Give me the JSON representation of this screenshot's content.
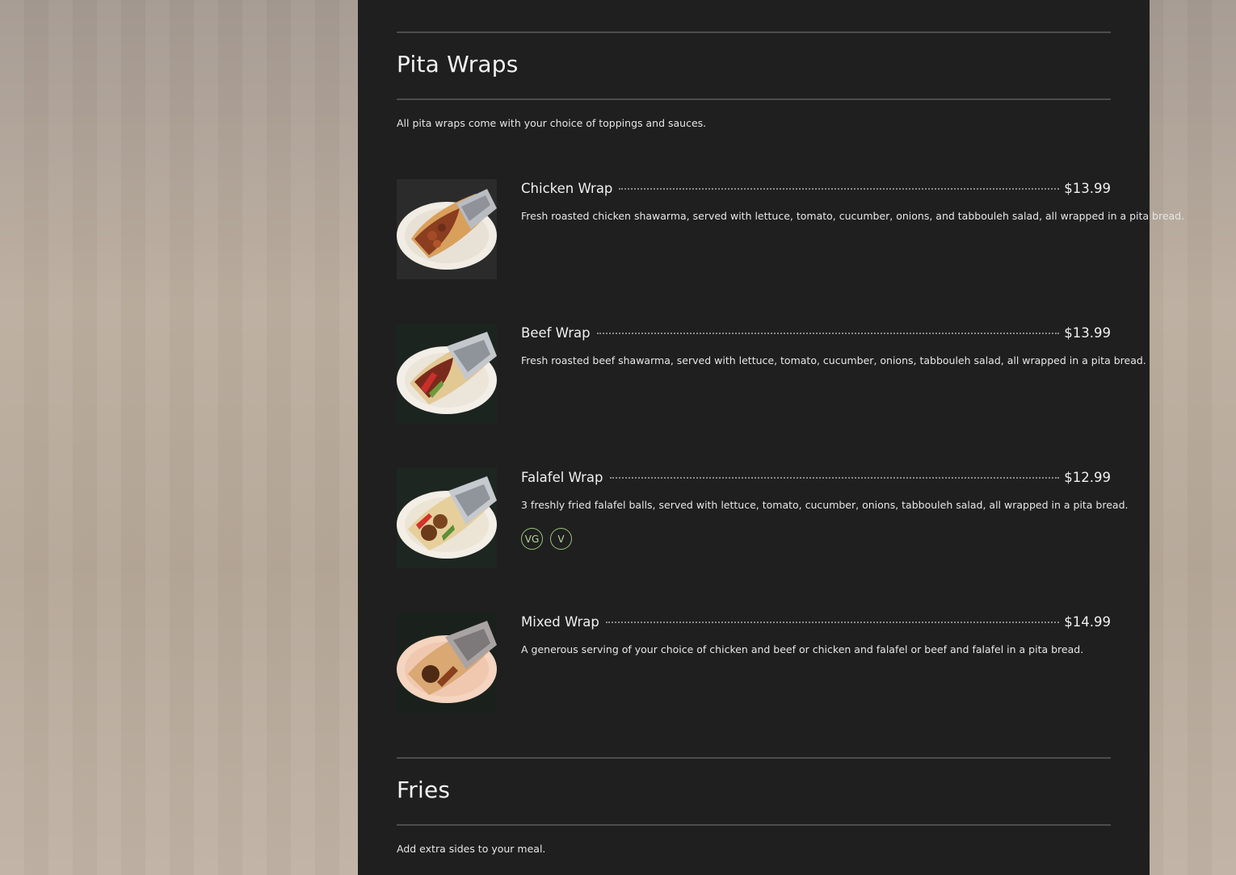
{
  "sections": [
    {
      "title": "Pita Wraps",
      "description": "All pita wraps come with your choice of toppings and sauces.",
      "items": [
        {
          "name": "Chicken Wrap",
          "price": "$13.99",
          "description": "Fresh roasted chicken shawarma, served with lettuce, tomato, cucumber, onions, and tabbouleh salad, all wrapped in a pita bread.",
          "image_icon": "chicken-wrap-photo",
          "badges": []
        },
        {
          "name": "Beef Wrap",
          "price": "$13.99",
          "description": "Fresh roasted beef shawarma, served with lettuce, tomato, cucumber, onions, tabbouleh salad, all wrapped in a pita bread.",
          "image_icon": "beef-wrap-photo",
          "badges": []
        },
        {
          "name": "Falafel Wrap",
          "price": "$12.99",
          "description": "3 freshly fried falafel balls, served with lettuce, tomato, cucumber, onions, tabbouleh salad, all wrapped in a pita bread.",
          "image_icon": "falafel-wrap-photo",
          "badges": [
            "VG",
            "V"
          ]
        },
        {
          "name": "Mixed Wrap",
          "price": "$14.99",
          "description": "A generous serving of your choice of chicken and beef or chicken and falafel or beef and falafel in a pita bread.",
          "image_icon": "mixed-wrap-photo",
          "badges": []
        }
      ]
    },
    {
      "title": "Fries",
      "description": "Add extra sides to your meal.",
      "items": []
    }
  ],
  "colors": {
    "panel_bg": "#1f1f1f",
    "badge_green": "#9bc47b",
    "rule": "#4d4d4d"
  }
}
